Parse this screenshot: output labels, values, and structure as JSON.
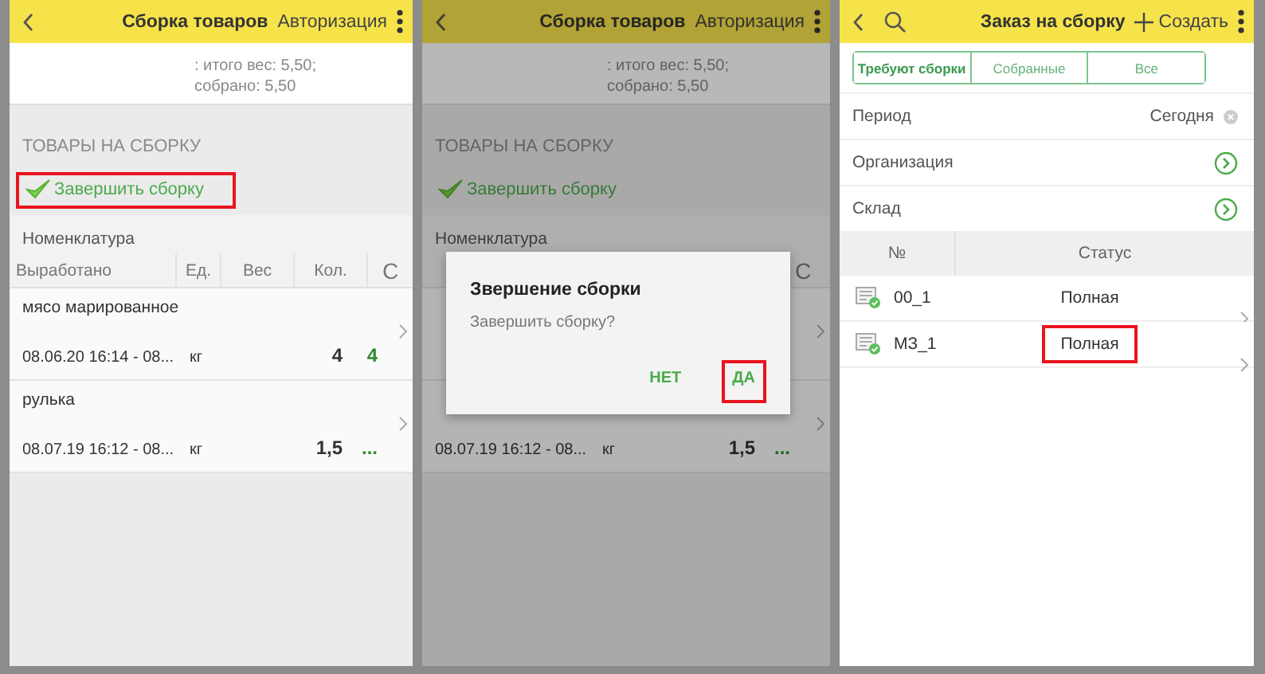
{
  "screens": [
    {
      "kind": "assembly",
      "dimmed": false,
      "title": "Сборка товаров",
      "action": "Авторизация",
      "summary": [
        ": итого вес: 5,50;",
        "собрано: 5,50"
      ],
      "section": "ТОВАРЫ НА СБОРКУ",
      "finish": {
        "label": "Завершить сборку",
        "highlighted": true
      },
      "group_label": "Номенклатура",
      "columns": [
        "Выработано",
        "Ед.",
        "Вес",
        "Кол.",
        "С"
      ],
      "rows": [
        {
          "name": "мясо марированное",
          "period": "08.06.20 16:14 - 08...",
          "unit": "кг",
          "qty": "4",
          "collected": "4"
        },
        {
          "name": "рулька",
          "period": "08.07.19 16:12 - 08...",
          "unit": "кг",
          "qty": "1,5",
          "collected": "..."
        }
      ]
    },
    {
      "kind": "assembly",
      "dimmed": true,
      "title": "Сборка товаров",
      "action": "Авторизация",
      "summary": [
        ": итого вес: 5,50;",
        "собрано: 5,50"
      ],
      "section": "ТОВАРЫ НА СБОРКУ",
      "finish": {
        "label": "Завершить сборку",
        "highlighted": false
      },
      "group_label": "Номенклатура",
      "columns": [
        "С"
      ],
      "rows": [
        {
          "period": "08.07.19 16:12 - 08...",
          "unit": "кг",
          "qty": "1,5",
          "collected": "..."
        }
      ],
      "dialog": {
        "title": "Звершение сборки",
        "message": "Завершить сборку?",
        "buttons": [
          {
            "label": "НЕТ",
            "highlighted": false
          },
          {
            "label": "ДА",
            "highlighted": true
          }
        ]
      }
    },
    {
      "kind": "orders",
      "title": "Заказ на сборку",
      "action": "Создать",
      "tabs": [
        {
          "label": "Требуют сборки",
          "selected": true
        },
        {
          "label": "Собранные",
          "selected": false
        },
        {
          "label": "Все",
          "selected": false
        }
      ],
      "filters": [
        {
          "kind": "value",
          "label": "Период",
          "value": "Сегодня"
        },
        {
          "kind": "link",
          "label": "Организация"
        },
        {
          "kind": "link",
          "label": "Склад"
        }
      ],
      "columns": [
        "№",
        "Статус"
      ],
      "rows": [
        {
          "number": "00_1",
          "status": "Полная",
          "highlighted": false
        },
        {
          "number": "МЗ_1",
          "status": "Полная",
          "highlighted": true
        }
      ]
    }
  ]
}
